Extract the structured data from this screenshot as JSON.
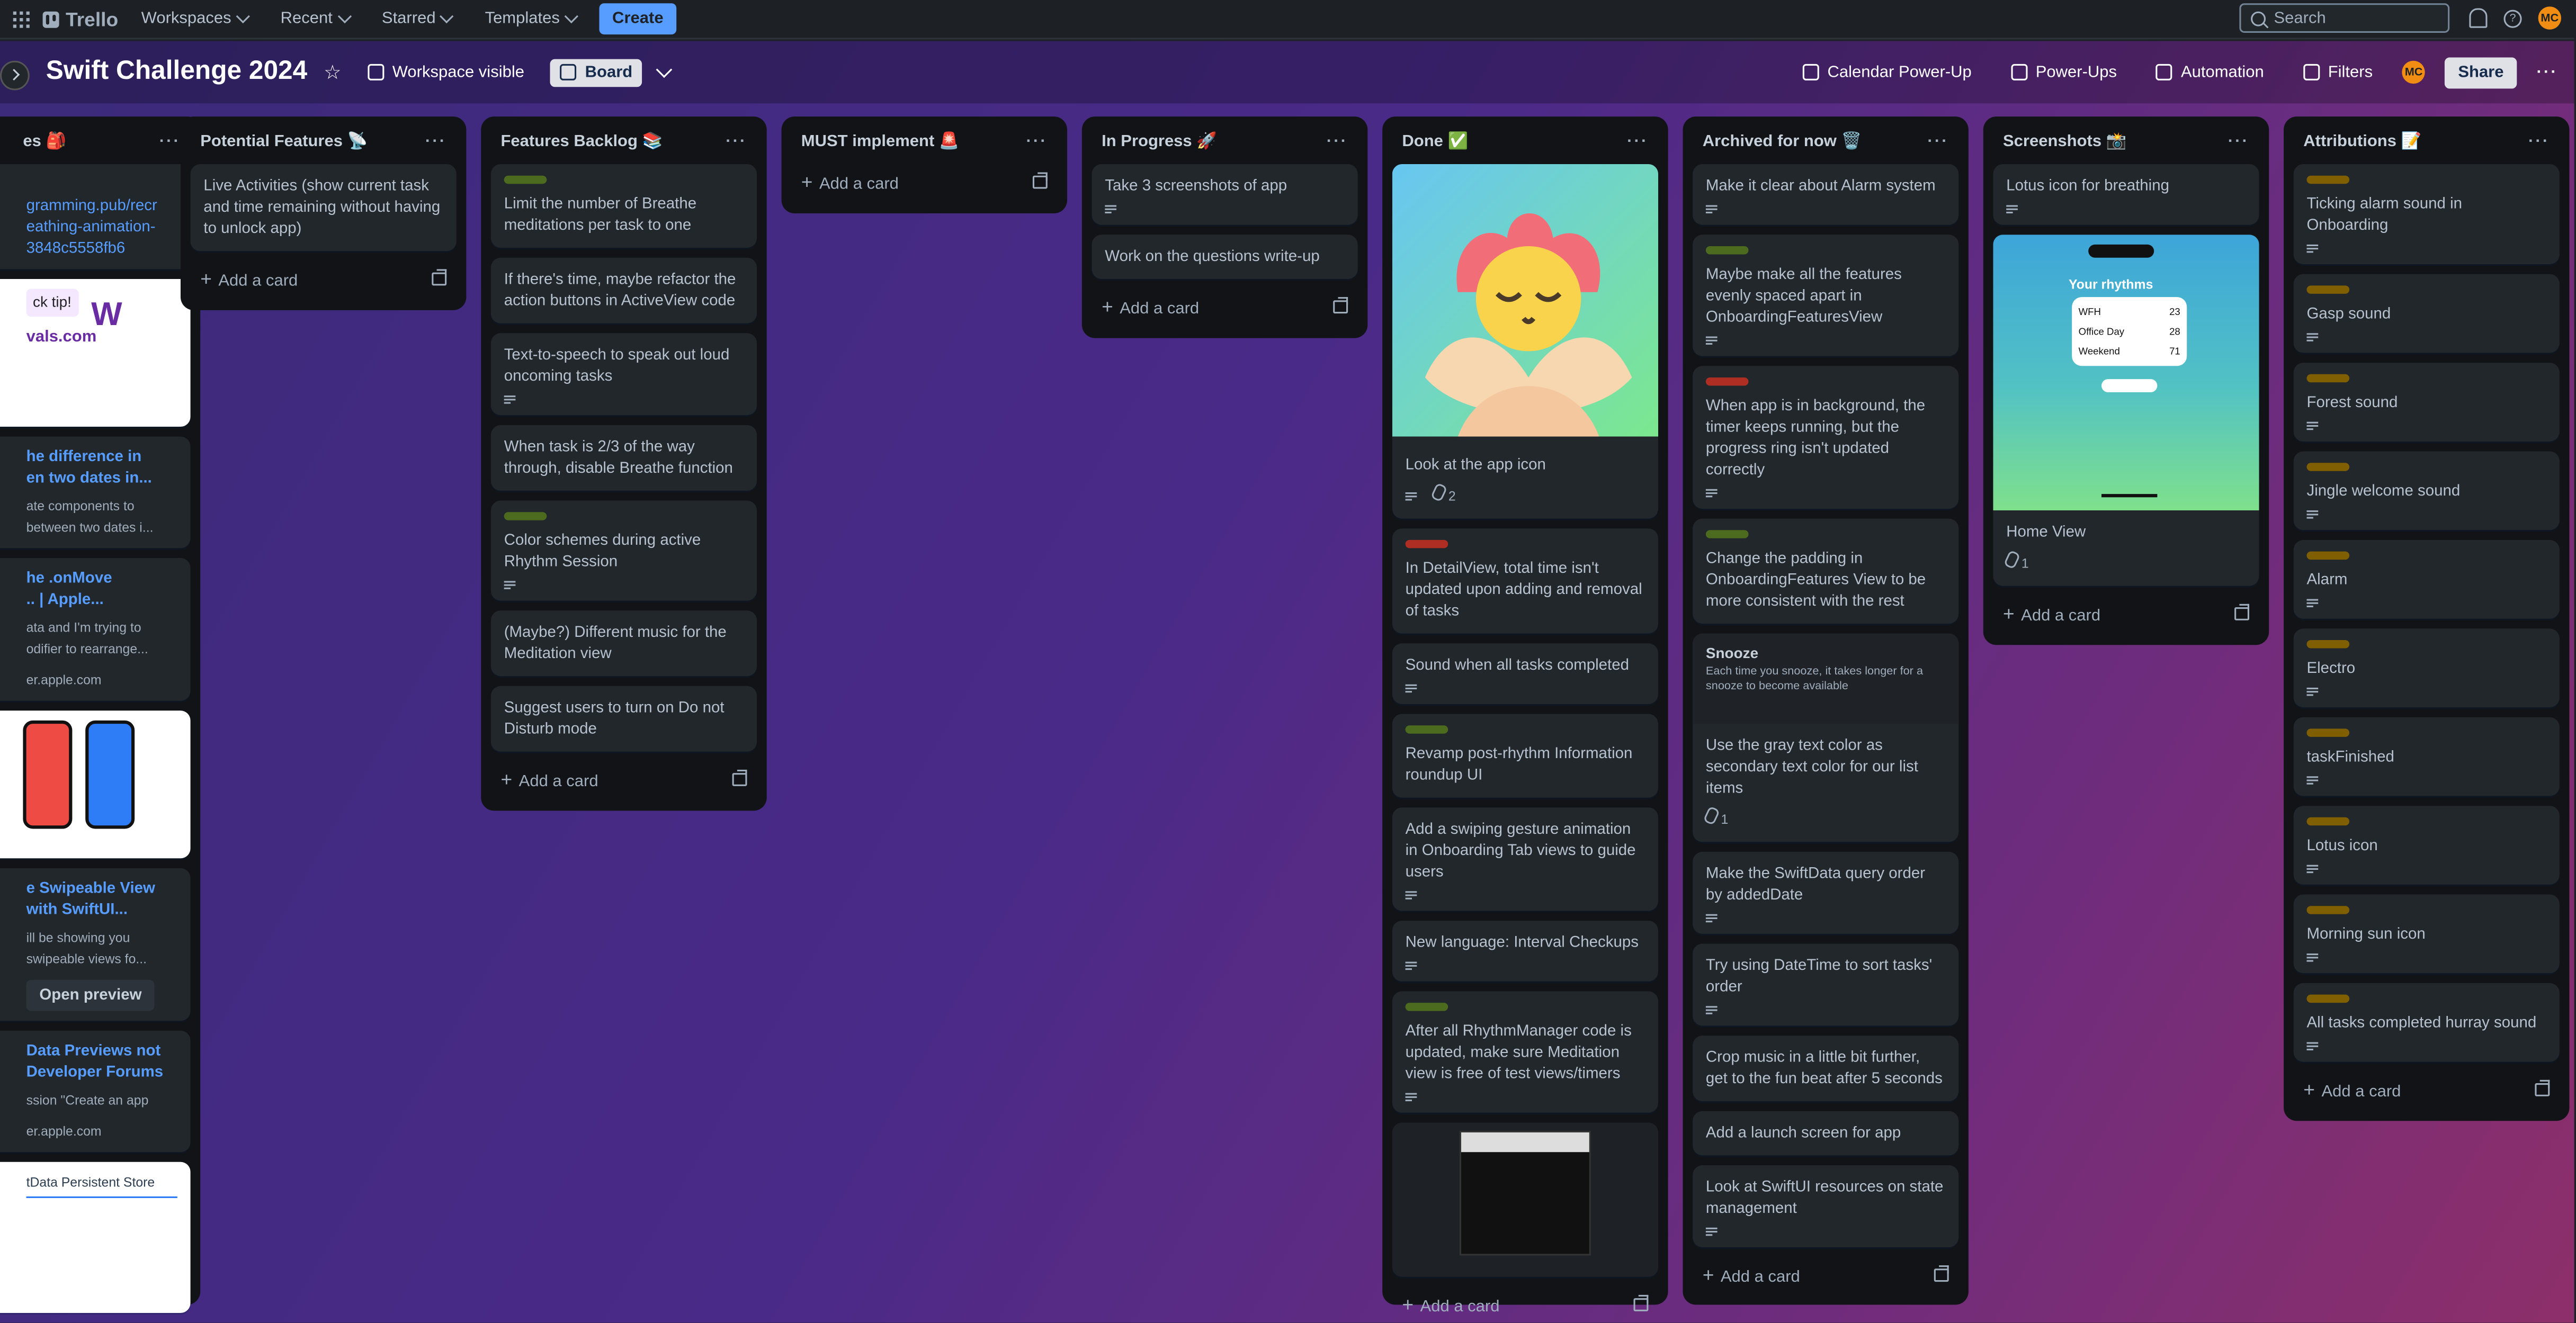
{
  "topbar": {
    "app_name": "Trello",
    "nav": [
      "Workspaces",
      "Recent",
      "Starred",
      "Templates"
    ],
    "create_label": "Create",
    "search_placeholder": "Search",
    "avatar_initials": "MC"
  },
  "boardbar": {
    "title": "Swift Challenge 2024",
    "visibility": "Workspace visible",
    "view": "Board",
    "calendar": "Calendar Power-Up",
    "powerups": "Power-Ups",
    "automation": "Automation",
    "filters": "Filters",
    "share": "Share",
    "avatar_initials": "MC"
  },
  "lists": {
    "partial": {
      "title": "es 🎒",
      "items": [
        {
          "text": "gramming.pub/recr\neathing-animation-\n3848c5558fb6"
        },
        {
          "text": "ck tip!"
        },
        {
          "text": "vals.com"
        },
        {
          "title": "he difference in\nen two dates in...",
          "sub": "ate components to\nbetween two dates i..."
        },
        {
          "title": "he .onMove\n.. | Apple...",
          "sub": "ata and I'm trying to\nodifier to rearrange...",
          "meta": "er.apple.com"
        },
        {
          "title": "e Swipeable View\n with SwiftUI...",
          "sub": "ill be showing you\n swipeable views fo...",
          "button": "Open preview"
        },
        {
          "title": "Data Previews not\nDeveloper Forums",
          "sub": "ssion \"Create an app",
          "meta": "er.apple.com"
        },
        {
          "text": "tData Persistent Store"
        }
      ]
    },
    "potential": {
      "title": "Potential Features 📡",
      "cards": [
        {
          "text": "Live Activities (show current task and time remaining without having to unlock app)"
        }
      ],
      "add": "Add a card"
    },
    "backlog": {
      "title": "Features Backlog 📚",
      "cards": [
        {
          "text": "Limit the number of Breathe meditations per task to one",
          "label": "#4c6b1f"
        },
        {
          "text": "If there's time, maybe refactor the action buttons in ActiveView code"
        },
        {
          "text": "Text-to-speech to speak out loud oncoming tasks",
          "desc": true
        },
        {
          "text": "When task is 2/3 of the way through, disable Breathe function"
        },
        {
          "text": "Color schemes during active Rhythm Session",
          "label": "#4c6b1f",
          "desc": true
        },
        {
          "text": "(Maybe?) Different music for the Meditation view"
        },
        {
          "text": "Suggest users to turn on Do not Disturb mode"
        }
      ],
      "add": "Add a card"
    },
    "must": {
      "title": "MUST implement 🚨",
      "add": "Add a card"
    },
    "progress": {
      "title": "In Progress 🚀",
      "cards": [
        {
          "text": "Take 3 screenshots of app",
          "desc": true
        },
        {
          "text": "Work on the questions write-up"
        }
      ],
      "add": "Add a card"
    },
    "done": {
      "title": "Done ✅",
      "cards": [
        {
          "text": "Look at the app icon",
          "desc": true,
          "attach": "2"
        },
        {
          "text": "In DetailView, total time isn't updated upon adding and removal of tasks",
          "label": "#ae2e24"
        },
        {
          "text": "Sound when all tasks completed",
          "desc": true
        },
        {
          "text": "Revamp post-rhythm Information roundup UI",
          "label": "#4c6b1f"
        },
        {
          "text": "Add a swiping gesture animation in Onboarding Tab views to guide users",
          "desc": true
        },
        {
          "text": "New language: Interval Checkups",
          "desc": true
        },
        {
          "text": "After all RhythmManager code is updated, make sure Meditation view is free of test views/timers",
          "label": "#4c6b1f",
          "desc": true
        }
      ],
      "add": "Add a card"
    },
    "archived": {
      "title": "Archived for now 🗑️",
      "cards": [
        {
          "text": "Make it clear about Alarm system",
          "desc": true
        },
        {
          "text": "Maybe make all the features evenly spaced apart in OnboardingFeaturesView",
          "label": "#4c6b1f",
          "desc": true
        },
        {
          "text": "When app is in background, the timer keeps running, but the progress ring isn't updated correctly",
          "label": "#ae2e24",
          "desc": true
        },
        {
          "text": "Change the padding in OnboardingFeatures View to be more consistent with the rest",
          "label": "#4c6b1f"
        },
        {
          "snooze_title": "Snooze",
          "snooze_sub": "Each time you snooze, it takes longer for a snooze to become available",
          "text": "Use the gray text color as secondary text color for our list items",
          "attach": "1"
        },
        {
          "text": "Make the SwiftData query order by addedDate",
          "desc": true
        },
        {
          "text": "Try using DateTime to sort tasks' order",
          "desc": true
        },
        {
          "text": "Crop music in a little bit further, get to the fun beat after 5 seconds"
        },
        {
          "text": "Add a launch screen for app"
        },
        {
          "text": "Look at SwiftUI resources on state management",
          "desc": true
        }
      ],
      "add": "Add a card"
    },
    "screenshots": {
      "title": "Screenshots 📸",
      "cards": [
        {
          "text": "Lotus icon for breathing",
          "desc": true
        },
        {
          "text": "Home View",
          "attach": "1",
          "phone_title": "Your rhythms",
          "rows": [
            [
              "WFH",
              "23"
            ],
            [
              "Office Day",
              "28"
            ],
            [
              "Weekend",
              "71"
            ]
          ]
        }
      ],
      "add": "Add a card"
    },
    "attributions": {
      "title": "Attributions 📝",
      "cards": [
        {
          "text": "Ticking alarm sound in Onboarding"
        },
        {
          "text": "Gasp sound"
        },
        {
          "text": "Forest sound"
        },
        {
          "text": "Jingle welcome sound"
        },
        {
          "text": "Alarm"
        },
        {
          "text": "Electro"
        },
        {
          "text": "taskFinished"
        },
        {
          "text": "Lotus icon"
        },
        {
          "text": "Morning sun icon"
        },
        {
          "text": "All tasks completed hurray sound"
        }
      ],
      "add": "Add a card"
    }
  }
}
